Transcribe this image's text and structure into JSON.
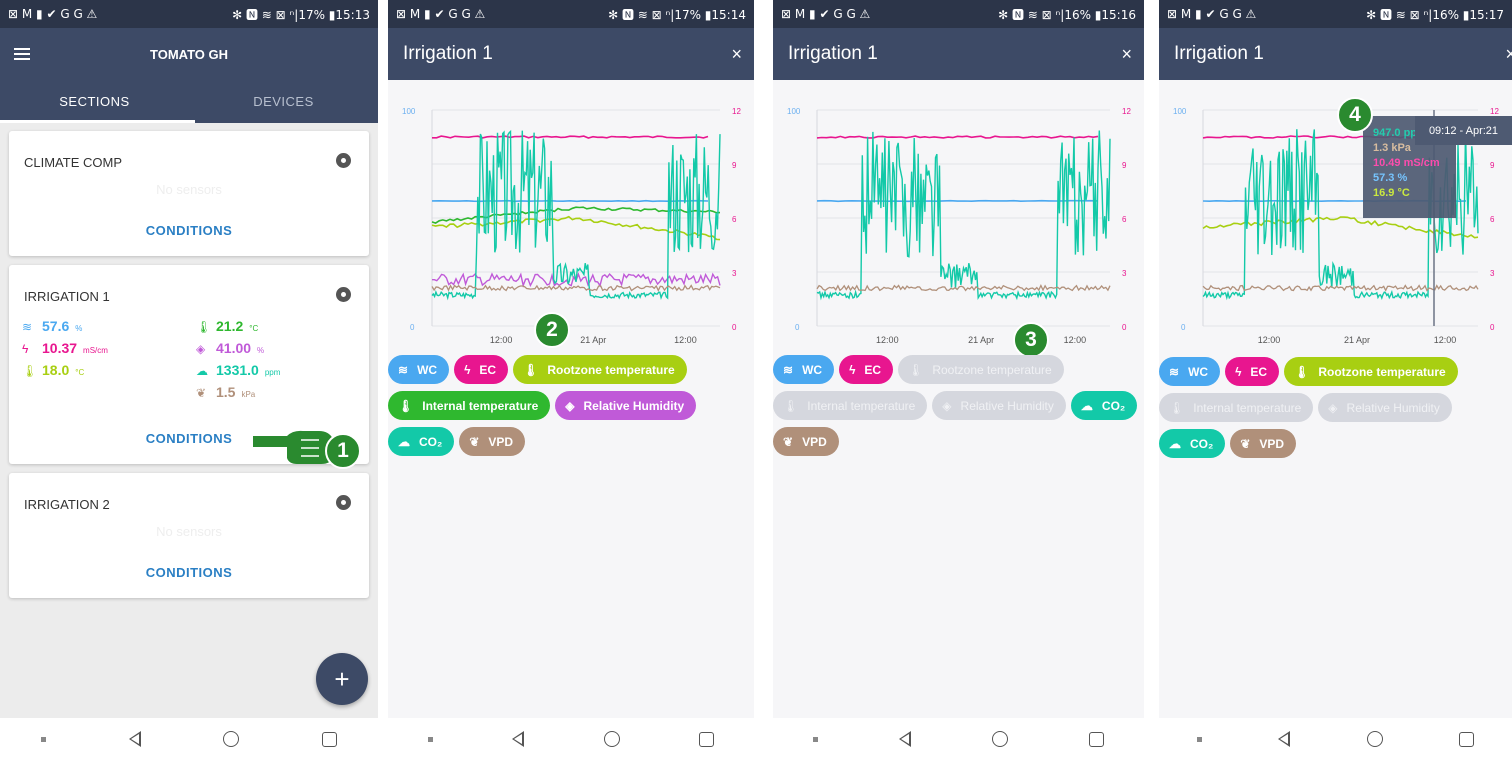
{
  "status_bars": [
    {
      "left_icons": "⊠ M ▮ ✔ G G ⚠",
      "right": "✻ 🅽 ≋ ⊠ ⁿ|17% ▮15:13",
      "time": "15:13",
      "battery": "17%"
    },
    {
      "left_icons": "⊠ M ▮ ✔ G G ⚠",
      "right": "✻ 🅽 ≋ ⊠ ⁿ|17% ▮15:14",
      "time": "15:14",
      "battery": "17%"
    },
    {
      "left_icons": "⊠ M ▮ ✔ G G ⚠",
      "right": "✻ 🅽 ≋ ⊠ ⁿ|16% ▮15:16",
      "time": "15:16",
      "battery": "16%"
    },
    {
      "left_icons": "⊠ M ▮ ✔ G G ⚠",
      "right": "✻ 🅽 ≋ ⊠ ⁿ|16% ▮15:17",
      "time": "15:17",
      "battery": "16%"
    }
  ],
  "panel1": {
    "app_title": "TOMATO GH",
    "tabs": [
      "SECTIONS",
      "DEVICES"
    ],
    "cards": [
      {
        "title": "CLIMATE COMP",
        "empty_text": "No sensors",
        "action": "CONDITIONS"
      },
      {
        "title": "IRRIGATION 1",
        "action": "CONDITIONS",
        "sensors": [
          {
            "icon": "≋",
            "value": "57.6",
            "unit": "%",
            "color": "#4aa8f0"
          },
          {
            "icon": "ϟ",
            "value": "10.37",
            "unit": "mS/cm",
            "color": "#e8168f"
          },
          {
            "icon": "🌡",
            "value": "18.0",
            "unit": "°C",
            "color": "#a8cf12"
          },
          {
            "icon": "🌡",
            "value": "21.2",
            "unit": "°C",
            "color": "#2fb82f"
          },
          {
            "icon": "◈",
            "value": "41.00",
            "unit": "%",
            "color": "#c05ad8"
          },
          {
            "icon": "☁",
            "value": "1331.0",
            "unit": "ppm",
            "color": "#13c9a8"
          },
          {
            "icon": "❦",
            "value": "1.5",
            "unit": "kPa",
            "color": "#b0907a"
          }
        ]
      },
      {
        "title": "IRRIGATION 2",
        "empty_text": "No sensors",
        "action": "CONDITIONS"
      }
    ],
    "fab": "+"
  },
  "modal_title": "Irrigation 1",
  "close": "×",
  "chart_axes": {
    "left_top": "100",
    "left_bottom": "0",
    "right_ticks": [
      "12",
      "9",
      "6",
      "3",
      "0"
    ],
    "x_ticks": [
      "12:00",
      "21 Apr",
      "12:00"
    ]
  },
  "chart_data": [
    {
      "type": "line",
      "title": "",
      "x": [
        "12:00",
        "21 Apr",
        "12:00"
      ],
      "y_left_range": [
        0,
        100
      ],
      "y_right_range": [
        0,
        12
      ],
      "series": [
        {
          "name": "WC",
          "color": "#4aa8f0"
        },
        {
          "name": "EC",
          "color": "#e8168f"
        },
        {
          "name": "Rootzone temperature",
          "color": "#a8cf12"
        },
        {
          "name": "Internal temperature",
          "color": "#2fb82f"
        },
        {
          "name": "Relative Humidity",
          "color": "#c05ad8"
        },
        {
          "name": "CO₂",
          "color": "#13c9a8"
        },
        {
          "name": "VPD",
          "color": "#b0907a"
        }
      ]
    },
    {
      "type": "line",
      "title": "",
      "x": [
        "12:00",
        "21 Apr",
        "12:00"
      ],
      "y_left_range": [
        0,
        100
      ],
      "y_right_range": [
        0,
        12
      ],
      "series": [
        {
          "name": "WC",
          "color": "#4aa8f0"
        },
        {
          "name": "EC",
          "color": "#e8168f"
        },
        {
          "name": "CO₂",
          "color": "#13c9a8"
        },
        {
          "name": "VPD",
          "color": "#b0907a"
        }
      ]
    },
    {
      "type": "line",
      "title": "",
      "x": [
        "12:00",
        "21 Apr",
        "12:00"
      ],
      "y_left_range": [
        0,
        100
      ],
      "y_right_range": [
        0,
        12
      ],
      "series": [
        {
          "name": "WC",
          "color": "#4aa8f0"
        },
        {
          "name": "EC",
          "color": "#e8168f"
        },
        {
          "name": "Rootzone temperature",
          "color": "#a8cf12"
        },
        {
          "name": "CO₂",
          "color": "#13c9a8"
        },
        {
          "name": "VPD",
          "color": "#b0907a"
        }
      ]
    }
  ],
  "chips": {
    "wc": "WC",
    "ec": "EC",
    "rootzone": "Rootzone temperature",
    "internal": "Internal temperature",
    "rh": "Relative Humidity",
    "co2": "CO₂",
    "vpd": "VPD"
  },
  "tooltip": {
    "time": "09:12 - Apr:21",
    "lines": [
      {
        "text": "947.0 pp",
        "color": "#13c9a8"
      },
      {
        "text": "1.3 kPa",
        "color": "#d6b898"
      },
      {
        "text": "10.49 mS/cm",
        "color": "#ff3fa8"
      },
      {
        "text": "57.3 %",
        "color": "#6cc0ff"
      },
      {
        "text": "16.9 °C",
        "color": "#c8e830"
      }
    ]
  },
  "steps": [
    "1",
    "2",
    "3",
    "4"
  ]
}
